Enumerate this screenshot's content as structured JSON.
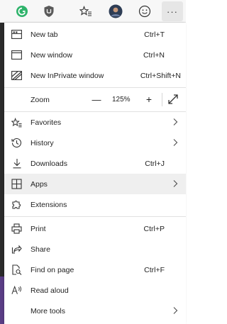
{
  "toolbar": {
    "icons": [
      "profile-sync-icon",
      "shield-icon",
      "favorites-star-icon",
      "avatar",
      "feedback-smiley-icon",
      "more-icon"
    ],
    "more_label": "···"
  },
  "menu": {
    "new_tab": {
      "label": "New tab",
      "shortcut": "Ctrl+T"
    },
    "new_window": {
      "label": "New window",
      "shortcut": "Ctrl+N"
    },
    "new_inprivate": {
      "label": "New InPrivate window",
      "shortcut": "Ctrl+Shift+N"
    },
    "zoom": {
      "label": "Zoom",
      "minus": "—",
      "value": "125%",
      "plus": "+"
    },
    "favorites": {
      "label": "Favorites"
    },
    "history": {
      "label": "History"
    },
    "downloads": {
      "label": "Downloads",
      "shortcut": "Ctrl+J"
    },
    "apps": {
      "label": "Apps"
    },
    "extensions": {
      "label": "Extensions"
    },
    "print": {
      "label": "Print",
      "shortcut": "Ctrl+P"
    },
    "share": {
      "label": "Share"
    },
    "find": {
      "label": "Find on page",
      "shortcut": "Ctrl+F"
    },
    "read_aloud": {
      "label": "Read aloud"
    },
    "more_tools": {
      "label": "More tools"
    }
  },
  "colors": {
    "accent_green": "#2fb36b",
    "highlight": "#efefef",
    "text": "#1f1f1f"
  }
}
